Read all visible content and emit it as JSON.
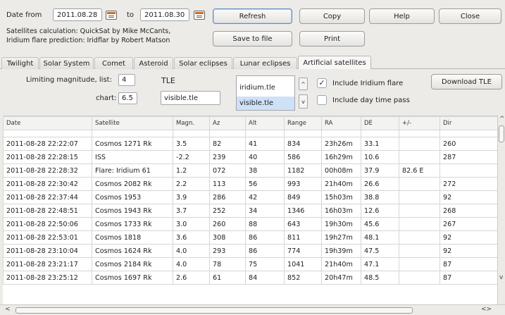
{
  "header": {
    "date_from_label": "Date from",
    "date_from_value": "2011.08.28",
    "to_label": "to",
    "date_to_value": "2011.08.30",
    "credit_line1": "Satellites calculation: QuickSat by Mike McCants,",
    "credit_line2": "Iridium flare prediction: Iridflar by Robert Matson",
    "buttons": {
      "refresh": "Refresh",
      "copy": "Copy",
      "help": "Help",
      "close": "Close",
      "save_to_file": "Save to file",
      "print": "Print"
    }
  },
  "tabs": [
    {
      "label": "Twilight"
    },
    {
      "label": "Solar System"
    },
    {
      "label": "Comet"
    },
    {
      "label": "Asteroid"
    },
    {
      "label": "Solar eclipses"
    },
    {
      "label": "Lunar eclipses"
    },
    {
      "label": "Artificial satellites"
    }
  ],
  "options": {
    "limiting_label": "Limiting magnitude, list:",
    "list_value": "4",
    "chart_label": "chart:",
    "chart_value": "6.5",
    "tle_label": "TLE",
    "tle_value": "visible.tle",
    "tle_list": [
      "iridium.tle",
      "visible.tle"
    ],
    "include_iridium_label": "Include Iridium flare",
    "include_iridium_checked": true,
    "include_daytime_label": "Include day time pass",
    "include_daytime_checked": false,
    "download_tle": "Download TLE"
  },
  "table": {
    "columns": [
      "Date",
      "Satellite",
      "Magn.",
      "Az",
      "Alt",
      "Range",
      "RA",
      "DE",
      "+/-",
      "Dir"
    ],
    "rows": [
      [
        "2011-08-28 22:22:07",
        "Cosmos 1271 Rk",
        "3.5",
        "82",
        "41",
        "834",
        "23h26m",
        "33.1",
        "",
        "260"
      ],
      [
        "2011-08-28 22:28:15",
        "ISS",
        "-2.2",
        "239",
        "40",
        "586",
        "16h29m",
        "10.6",
        "",
        "287"
      ],
      [
        "2011-08-28 22:28:32",
        "Flare: Iridium 61",
        "1.2",
        "072",
        "38",
        "1182",
        "00h08m",
        "37.9",
        "82.6 E",
        ""
      ],
      [
        "2011-08-28 22:30:42",
        "Cosmos 2082 Rk",
        "2.2",
        "113",
        "56",
        "993",
        "21h40m",
        "26.6",
        "",
        "272"
      ],
      [
        "2011-08-28 22:37:44",
        "Cosmos 1953",
        "3.9",
        "286",
        "42",
        "849",
        "15h03m",
        "38.8",
        "",
        "92"
      ],
      [
        "2011-08-28 22:48:51",
        "Cosmos 1943 Rk",
        "3.7",
        "252",
        "34",
        "1346",
        "16h03m",
        "12.6",
        "",
        "268"
      ],
      [
        "2011-08-28 22:50:06",
        "Cosmos 1733 Rk",
        "3.0",
        "260",
        "88",
        "643",
        "19h30m",
        "45.6",
        "",
        "267"
      ],
      [
        "2011-08-28 22:53:01",
        "Cosmos 1818",
        "3.6",
        "308",
        "86",
        "811",
        "19h27m",
        "48.1",
        "",
        "92"
      ],
      [
        "2011-08-28 23:10:04",
        "Cosmos 1624 Rk",
        "4.0",
        "293",
        "86",
        "774",
        "19h39m",
        "47.5",
        "",
        "92"
      ],
      [
        "2011-08-28 23:21:17",
        "Cosmos 2184 Rk",
        "4.0",
        "78",
        "75",
        "1041",
        "21h40m",
        "47.1",
        "",
        "87"
      ],
      [
        "2011-08-28 23:25:12",
        "Cosmos 1697 Rk",
        "2.6",
        "61",
        "84",
        "852",
        "20h47m",
        "48.5",
        "",
        "87"
      ]
    ]
  },
  "scroll": {
    "left_arrow": "<",
    "right_arrows": "<>",
    "up_arrow": "^",
    "down_arrow": "v"
  }
}
